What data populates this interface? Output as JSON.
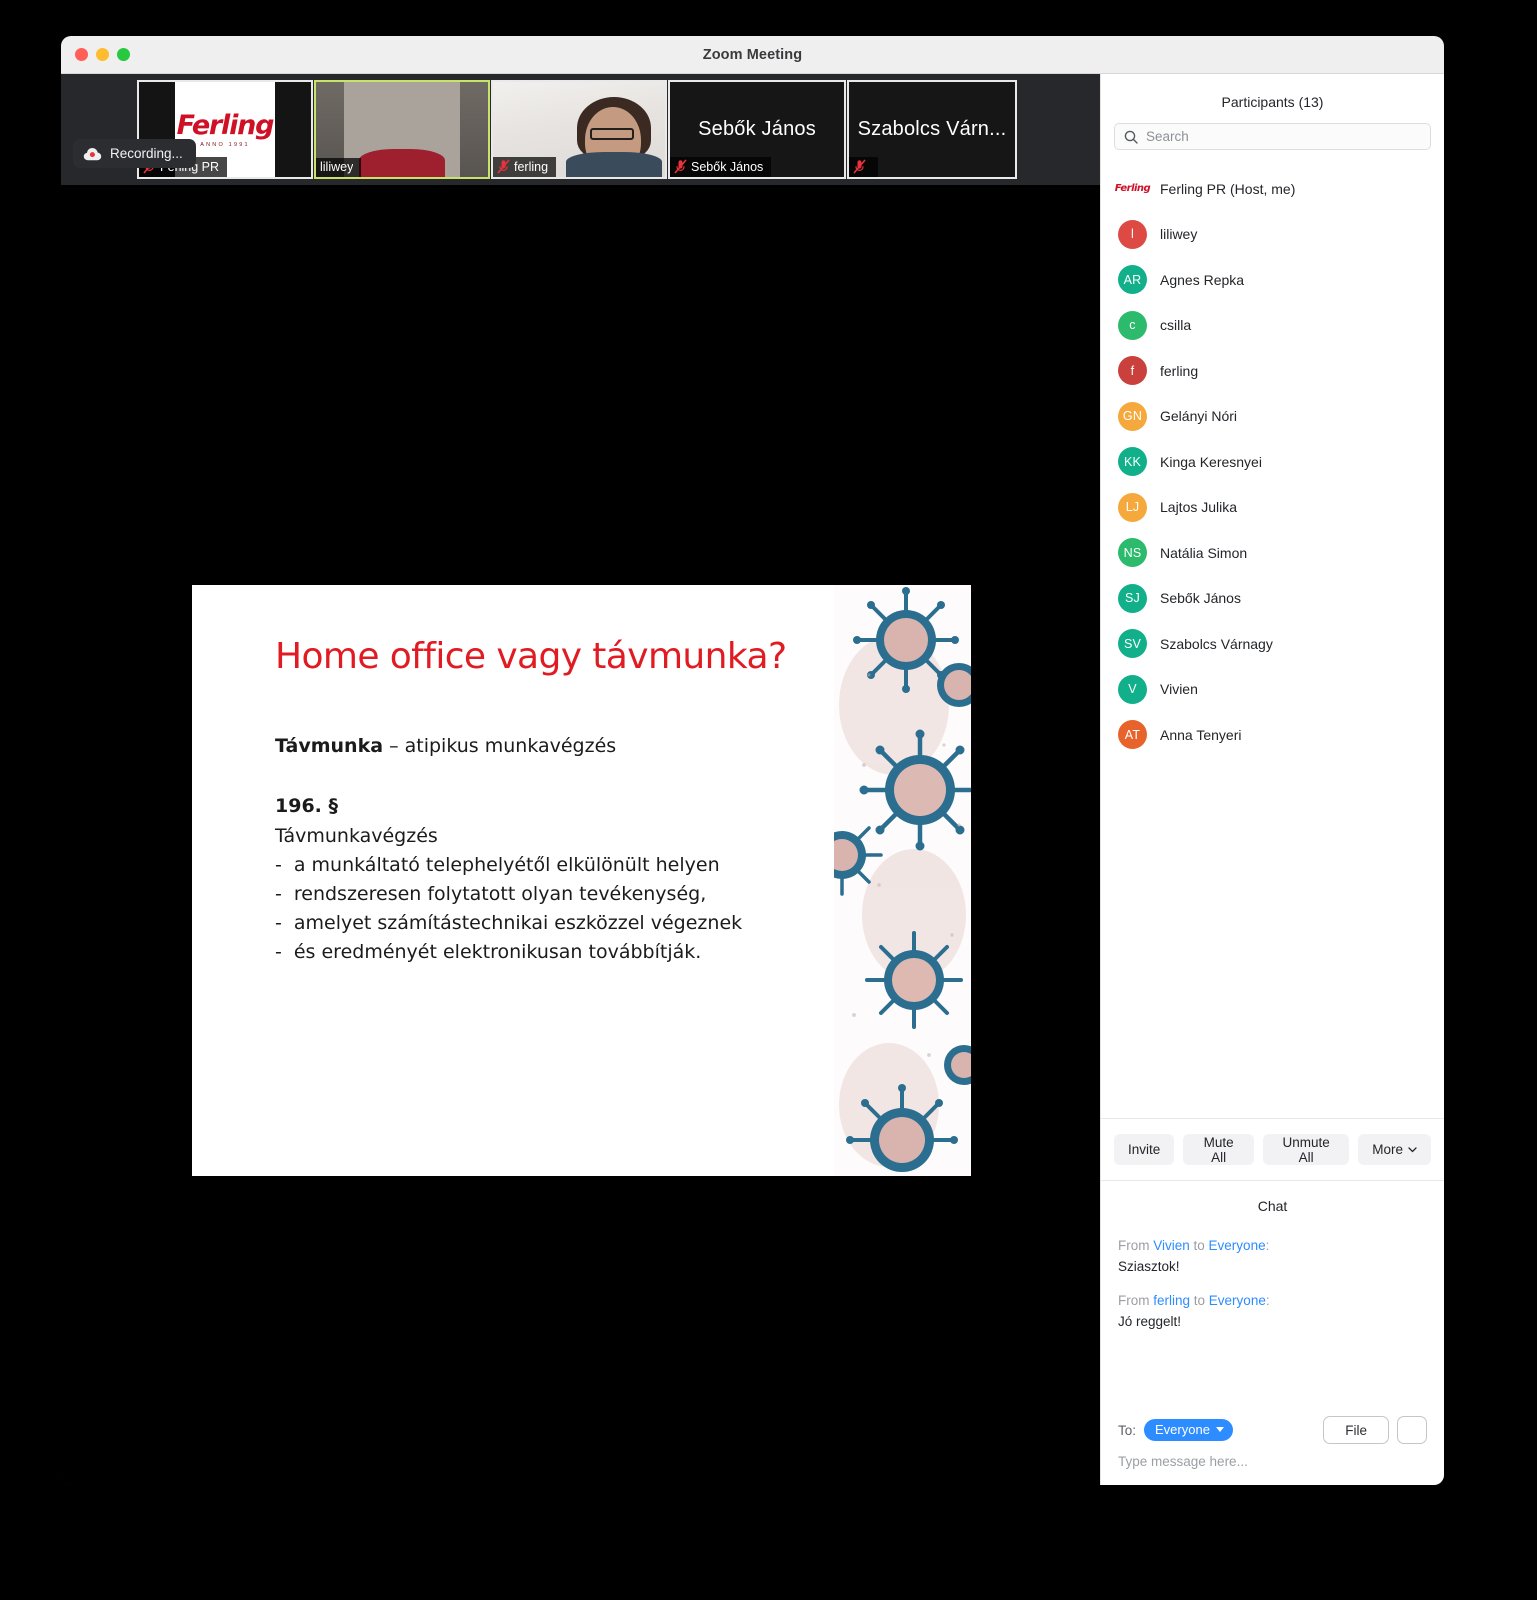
{
  "window": {
    "title": "Zoom Meeting",
    "traffic_lights": [
      "close",
      "minimize",
      "maximize"
    ]
  },
  "meeting": {
    "recording_label": "Recording...",
    "filmstrip": [
      {
        "name": "Ferling PR",
        "display": "",
        "kind": "logo",
        "muted": true,
        "active": false,
        "logo_word": "Ferling",
        "logo_sub": "ANNO 1991"
      },
      {
        "name": "liliwey",
        "display": "",
        "kind": "video",
        "muted": false,
        "active": true
      },
      {
        "name": "ferling",
        "display": "",
        "kind": "video",
        "muted": true,
        "active": false
      },
      {
        "name": "Sebők János",
        "display": "Sebők János",
        "kind": "name",
        "muted": true,
        "active": false
      },
      {
        "name": "",
        "display": "Szabolcs Várn...",
        "kind": "name",
        "muted": true,
        "active": false
      }
    ]
  },
  "slide": {
    "title": "Home office vagy távmunka?",
    "subtitle_bold": "Távmunka",
    "subtitle_rest": " – atipikus munkavégzés",
    "section": "196. §",
    "line": "Távmunkavégzés",
    "bullet_mark": "-",
    "bullets": [
      "a munkáltató telephelyétől elkülönült helyen",
      "rendszeresen folytatott olyan tevékenység,",
      "amelyet számítástechnikai eszközzel végeznek",
      "és eredményét elektronikusan továbbítják."
    ]
  },
  "panel": {
    "header": "Participants (13)",
    "search": {
      "placeholder": "Search",
      "value": ""
    },
    "participants": [
      {
        "name": "Ferling PR (Host, me)",
        "initials": "Ferling",
        "color": "#ffffff",
        "logo": true
      },
      {
        "name": "liliwey",
        "initials": "l",
        "color": "#dd4a43"
      },
      {
        "name": "Agnes Repka",
        "initials": "AR",
        "color": "#11b08a"
      },
      {
        "name": "csilla",
        "initials": "c",
        "color": "#2cbb6d"
      },
      {
        "name": "ferling",
        "initials": "f",
        "color": "#c9403c"
      },
      {
        "name": "Gelányi Nóri",
        "initials": "GN",
        "color": "#f5a83c"
      },
      {
        "name": "Kinga Keresnyei",
        "initials": "KK",
        "color": "#11b08a"
      },
      {
        "name": "Lajtos Julika",
        "initials": "LJ",
        "color": "#f5a83c"
      },
      {
        "name": "Natália Simon",
        "initials": "NS",
        "color": "#2cbb6d"
      },
      {
        "name": "Sebők János",
        "initials": "SJ",
        "color": "#11b08a"
      },
      {
        "name": "Szabolcs Várnagy",
        "initials": "SV",
        "color": "#11b08a"
      },
      {
        "name": "Vivien",
        "initials": "V",
        "color": "#11b08a"
      },
      {
        "name": "Anna Tenyeri",
        "initials": "AT",
        "color": "#e8622c"
      }
    ],
    "actions": {
      "invite": "Invite",
      "mute_all": "Mute All",
      "unmute_all": "Unmute All",
      "more": "More"
    }
  },
  "chat": {
    "header": "Chat",
    "messages": [
      {
        "prefix": "From ",
        "from": "Vivien",
        "mid": " to ",
        "to": "Everyone",
        "suffix": ":",
        "body": "Sziasztok!"
      },
      {
        "prefix": "From ",
        "from": "ferling",
        "mid": " to ",
        "to": "Everyone",
        "suffix": ":",
        "body": "Jó reggelt!"
      }
    ],
    "to_label": "To:",
    "to_value": "Everyone",
    "file_label": "File",
    "input_placeholder": "Type message here...",
    "input_value": ""
  },
  "colors": {
    "accent_blue": "#2d8cff",
    "brand_red": "#cf1128",
    "slide_title_red": "#e01b22",
    "active_tile_border": "#c9e26a"
  }
}
